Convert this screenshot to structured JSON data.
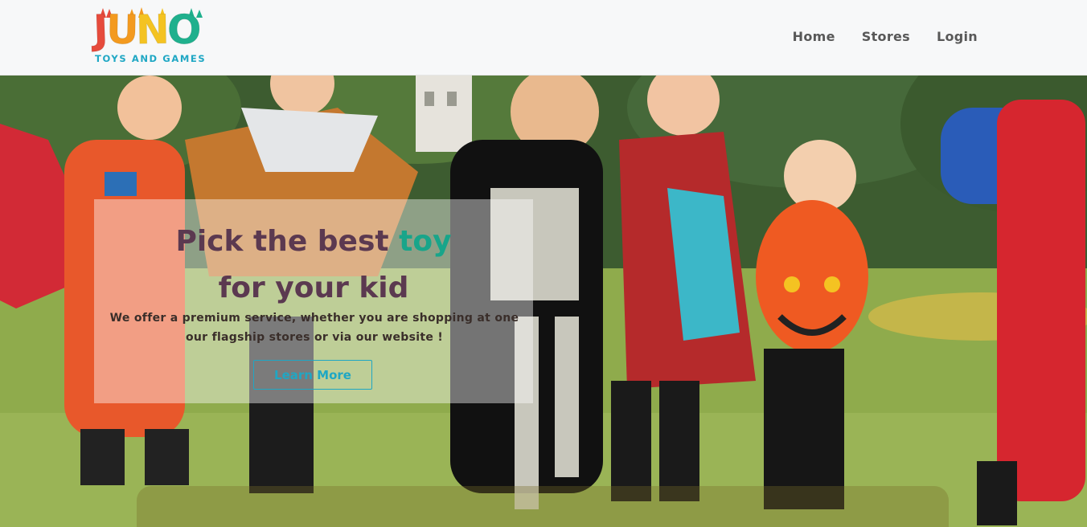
{
  "brand": {
    "letters": [
      "J",
      "U",
      "N",
      "O"
    ],
    "tagline": "TOYS AND GAMES",
    "colors": {
      "j": "#e64b3c",
      "u": "#f39a1f",
      "n": "#f4c322",
      "o": "#1fb08d",
      "tagline": "#1fa7c4"
    }
  },
  "nav": {
    "home": "Home",
    "stores": "Stores",
    "login": "Login"
  },
  "hero": {
    "headline_part1": "Pick the best ",
    "headline_accent": "toy",
    "headline_line2": "for your kid",
    "subtext": "We offer a premium service, whether you are shopping at one our flagship stores or via our website !",
    "cta_label": "Learn More",
    "image_description_icon": "kids-in-costumes-photo"
  },
  "colors": {
    "headline": "#5b3950",
    "accent": "#18a58a",
    "cta": "#1fa7c4",
    "nav_text": "#585858",
    "header_bg": "#f7f8f9"
  }
}
